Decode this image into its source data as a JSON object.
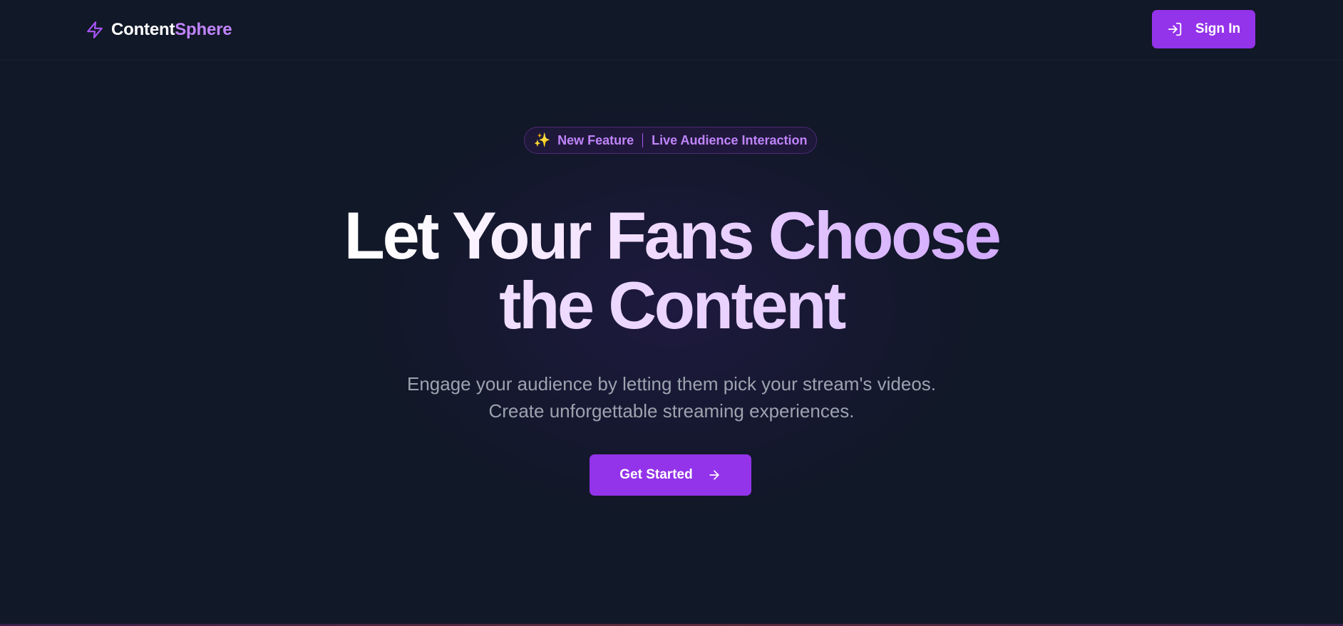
{
  "header": {
    "brand_prefix": "Content",
    "brand_suffix": "Sphere",
    "brand_icon": "lightning-icon",
    "signin_label": "Sign In",
    "signin_icon": "sign-in-icon"
  },
  "badge": {
    "icon": "sparkles-icon",
    "sparkle": "✨",
    "label": "New Feature",
    "text": "Live Audience Interaction"
  },
  "hero": {
    "title_line1": "Let Your Fans Choose",
    "title_line2": "the Content",
    "subtitle_line1": "Engage your audience by letting them pick your stream's videos.",
    "subtitle_line2": "Create unforgettable streaming experiences.",
    "cta_label": "Get Started",
    "cta_icon": "arrow-right-icon"
  },
  "colors": {
    "background": "#111827",
    "accent": "#9333ea",
    "accent_text": "#c084fc",
    "muted_text": "#9ca3af"
  }
}
